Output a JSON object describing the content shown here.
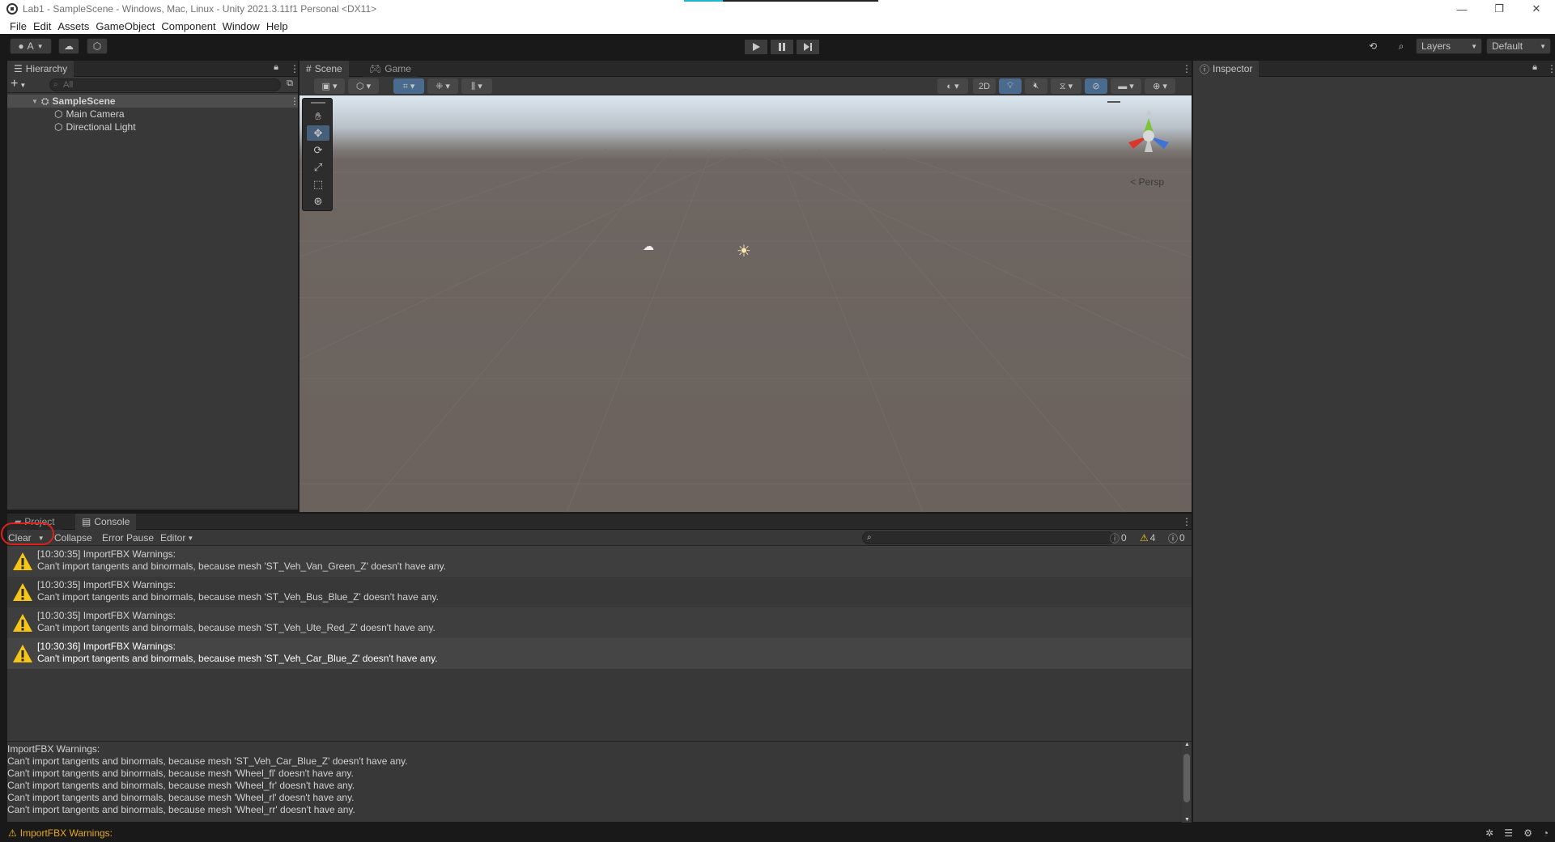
{
  "window": {
    "title": "Lab1 - SampleScene - Windows, Mac, Linux - Unity 2021.3.11f1 Personal <DX11>",
    "controls": [
      "—",
      "❐",
      "✕"
    ]
  },
  "menu": [
    "File",
    "Edit",
    "Assets",
    "GameObject",
    "Component",
    "Window",
    "Help"
  ],
  "toolbar": {
    "account_label": "A",
    "layers_label": "Layers",
    "layout_label": "Default"
  },
  "hierarchy": {
    "tab": "Hierarchy",
    "search_placeholder": "All",
    "scene": "SampleScene",
    "items": [
      "Main Camera",
      "Directional Light"
    ]
  },
  "scene_view": {
    "tabs": [
      "Scene",
      "Game"
    ],
    "btn_2d": "2D",
    "persp_label": "Persp"
  },
  "inspector": {
    "tab": "Inspector"
  },
  "console": {
    "tabs": [
      "Project",
      "Console"
    ],
    "clear": "Clear",
    "collapse": "Collapse",
    "error_pause": "Error Pause",
    "editor": "Editor",
    "counts": {
      "info": "0",
      "warnings": "4",
      "errors": "0"
    },
    "logs": [
      {
        "line1": "[10:30:35] ImportFBX Warnings:",
        "line2": "Can't import tangents and binormals, because mesh 'ST_Veh_Van_Green_Z' doesn't have any."
      },
      {
        "line1": "[10:30:35] ImportFBX Warnings:",
        "line2": "Can't import tangents and binormals, because mesh 'ST_Veh_Bus_Blue_Z' doesn't have any."
      },
      {
        "line1": "[10:30:35] ImportFBX Warnings:",
        "line2": "Can't import tangents and binormals, because mesh 'ST_Veh_Ute_Red_Z' doesn't have any."
      },
      {
        "line1": "[10:30:36] ImportFBX Warnings:",
        "line2": "Can't import tangents and binormals, because mesh 'ST_Veh_Car_Blue_Z' doesn't have any."
      }
    ],
    "detail": [
      "ImportFBX Warnings:",
      "Can't import tangents and binormals, because mesh 'ST_Veh_Car_Blue_Z' doesn't have any.",
      "Can't import tangents and binormals, because mesh 'Wheel_fl' doesn't have any.",
      "Can't import tangents and binormals, because mesh 'Wheel_fr' doesn't have any.",
      "Can't import tangents and binormals, because mesh 'Wheel_rl' doesn't have any.",
      "Can't import tangents and binormals, because mesh 'Wheel_rr' doesn't have any."
    ]
  },
  "status": {
    "message": "ImportFBX Warnings:"
  },
  "colors": {
    "warning": "#f5c518",
    "highlight_annotation": "#e0201a",
    "selection": "#46607c"
  }
}
